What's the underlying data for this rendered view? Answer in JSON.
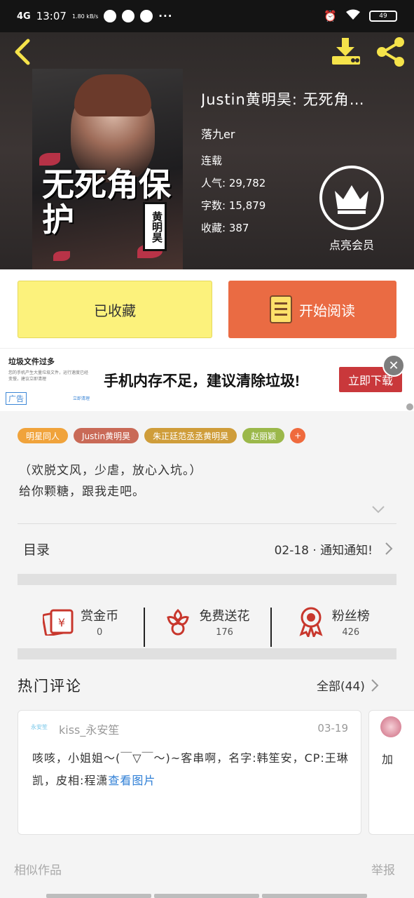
{
  "status_bar": {
    "signal": "4G",
    "time": "13:07",
    "net_speed": "1.80 kB/s",
    "battery": "49"
  },
  "book": {
    "title": "Justin黄明昊: 无死角…",
    "author": "落九er",
    "status": "连载",
    "stats": [
      {
        "label": "人气",
        "value": "29,782"
      },
      {
        "label": "字数",
        "value": "15,879"
      },
      {
        "label": "收藏",
        "value": "387"
      }
    ],
    "cover_title": "无死角保护",
    "cover_stamp": "黄明昊"
  },
  "vip": {
    "label": "点亮会员"
  },
  "actions": {
    "favorited": "已收藏",
    "read": "开始阅读"
  },
  "ad": {
    "card_title": "垃圾文件过多",
    "card_desc": "您的手机产生大量垃圾文件，运行速度已经变慢，建议立即清理",
    "tag": "广告",
    "clean": "立即清理",
    "headline": "手机内存不足，建议清除垃圾!",
    "button": "立即下载"
  },
  "tags": [
    "明星同人",
    "Justin黄明昊",
    "朱正廷范丞丞黄明昊",
    "赵丽颖",
    "+"
  ],
  "intro": [
    "（欢脱文风，少虐，放心入坑。）",
    "给你颗糖，跟我走吧。"
  ],
  "toc": {
    "label": "目录",
    "latest": "02-18 · 通知通知!"
  },
  "rewards": [
    {
      "name": "赏金币",
      "value": "0"
    },
    {
      "name": "免费送花",
      "value": "176"
    },
    {
      "name": "粉丝榜",
      "value": "426"
    }
  ],
  "comments": {
    "title": "热门评论",
    "all_label": "全部(44)",
    "items": [
      {
        "level": "永安笙",
        "user": "kiss_永安笙",
        "date": "03-19",
        "text": "咳咳，小姐姐～(￣▽￣～)~客串啊，名字:韩笙安，CP:王琳凯，皮相:程潇",
        "link": "查看图片"
      }
    ],
    "peek_text": "加"
  },
  "footer": {
    "similar": "相似作品",
    "report": "举报"
  },
  "colors": {
    "accent": "#ea6b43",
    "fav": "#fcf27c",
    "icon_yellow": "#f5e34a",
    "reward_red": "#c8372d"
  }
}
